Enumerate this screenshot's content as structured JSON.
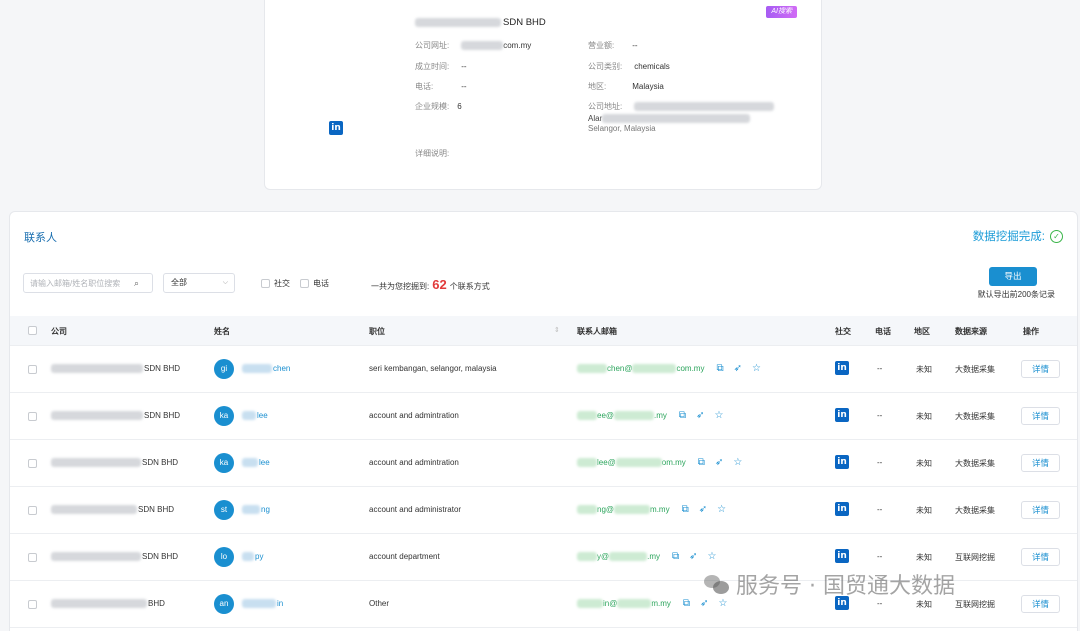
{
  "company": {
    "name_suffix": "SDN BHD",
    "ai_badge": "AI搜索",
    "linkedin_icon": "in",
    "fields": {
      "website_label": "公司网址:",
      "website_value": "com.my",
      "revenue_label": "营业额:",
      "revenue_value": "--",
      "founded_label": "成立时间:",
      "founded_value": "--",
      "type_label": "公司类别:",
      "type_value": "chemicals",
      "phone_label": "电话:",
      "phone_value": "--",
      "region_label": "地区:",
      "region_value": "Malaysia",
      "size_label": "企业规模:",
      "size_value": "6",
      "address_label": "公司地址:",
      "address_line2": "Alar",
      "address_line3": "Selangor, Malaysia",
      "details_label": "详细说明:"
    }
  },
  "contacts": {
    "title": "联系人",
    "status": "数据挖掘完成:",
    "search_placeholder": "请输入邮箱/姓名职位搜索",
    "filter_value": "全部",
    "social_label": "社交",
    "phone_label": "电话",
    "total_prefix": "一共为您挖掘到:",
    "total_count": "62",
    "total_suffix": "个联系方式",
    "export_label": "导出",
    "export_note": "默认导出前200条记录",
    "columns": {
      "company": "公司",
      "name": "姓名",
      "position": "职位",
      "email": "联系人邮箱",
      "social": "社交",
      "phone": "电话",
      "region": "地区",
      "source": "数据来源",
      "action": "操作"
    },
    "rows": [
      {
        "company": "SDN BHD",
        "initials": "gi",
        "name": "chen",
        "position": "seri kembangan, selangor, malaysia",
        "email_a": "chen@",
        "email_b": "com.my",
        "phone": "--",
        "region": "未知",
        "source": "大数据采集",
        "source_kind": "blue",
        "detail": "详情"
      },
      {
        "company": "SDN BHD",
        "initials": "ka",
        "name": "lee",
        "position": "account and admintration",
        "email_a": "ee@",
        "email_b": ".my",
        "phone": "--",
        "region": "未知",
        "source": "大数据采集",
        "source_kind": "blue",
        "detail": "详情"
      },
      {
        "company": "SDN BHD",
        "initials": "ka",
        "name": "lee",
        "position": "account and admintration",
        "email_a": "lee@",
        "email_b": "om.my",
        "phone": "--",
        "region": "未知",
        "source": "大数据采集",
        "source_kind": "blue",
        "detail": "详情"
      },
      {
        "company": "SDN BHD",
        "initials": "st",
        "name": "ng",
        "position": "account and administrator",
        "email_a": "ng@",
        "email_b": "m.my",
        "phone": "--",
        "region": "未知",
        "source": "大数据采集",
        "source_kind": "blue",
        "detail": "详情"
      },
      {
        "company": "SDN BHD",
        "initials": "lo",
        "name": "py",
        "position": "account department",
        "email_a": "y@",
        "email_b": ".my",
        "phone": "--",
        "region": "未知",
        "source": "互联网挖掘",
        "source_kind": "orange",
        "detail": "详情"
      },
      {
        "company": "BHD",
        "initials": "an",
        "name": "in",
        "position": "Other",
        "email_a": "in@",
        "email_b": "m.my",
        "phone": "--",
        "region": "未知",
        "source": "互联网挖掘",
        "source_kind": "orange",
        "detail": "详情"
      }
    ]
  },
  "watermark": "服务号 · 国贸通大数据",
  "colors": {
    "accent": "#1a8fd0",
    "linkedin": "#0a66c2",
    "highlight_red": "#e23b3b",
    "email_green": "#2aa45b",
    "source_orange": "#f0a020",
    "success_green": "#3bb54a"
  }
}
